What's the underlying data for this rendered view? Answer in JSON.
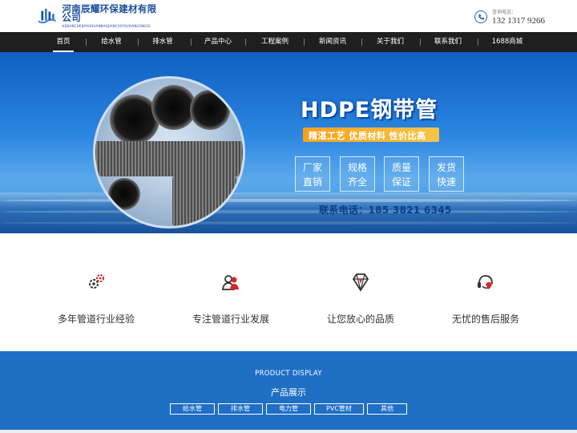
{
  "header": {
    "logo_cn": "河南辰耀环保建材有限公司",
    "logo_en": "HENANCHENYAOHUANBAOJIANCAIYOUXIANGONGSI",
    "hotline_label": "咨询电话：",
    "hotline_number": "132 1317 9266"
  },
  "nav": {
    "items": [
      {
        "label": "首页",
        "active": true
      },
      {
        "label": "给水管"
      },
      {
        "label": "排水管"
      },
      {
        "label": "产品中心"
      },
      {
        "label": "工程案例"
      },
      {
        "label": "新闻资讯"
      },
      {
        "label": "关于我们"
      },
      {
        "label": "联系我们"
      },
      {
        "label": "1688商城"
      }
    ]
  },
  "banner": {
    "title": "HDPE钢带管",
    "tagline": "精湛工艺 优质材料 性价比高",
    "features": [
      {
        "line1": "厂家",
        "line2": "直销"
      },
      {
        "line1": "规格",
        "line2": "齐全"
      },
      {
        "line1": "质量",
        "line2": "保证"
      },
      {
        "line1": "发货",
        "line2": "快速"
      }
    ],
    "contact": "联系电话：185 3821 6345"
  },
  "features": [
    {
      "label": "多年管道行业经验",
      "icon": "gears-icon"
    },
    {
      "label": "专注管道行业发展",
      "icon": "team-icon"
    },
    {
      "label": "让您放心的品质",
      "icon": "diamond-icon"
    },
    {
      "label": "无忧的售后服务",
      "icon": "headset-icon"
    }
  ],
  "products": {
    "title_en": "PRODUCT DISPLAY",
    "title_cn": "产品展示",
    "tabs": [
      "给水管",
      "排水管",
      "电力管",
      "PVC管材",
      "其他"
    ]
  },
  "colors": {
    "nav_bg": "#1f1f1f",
    "brand_blue": "#1a4f9c",
    "product_bg": "#1f6fc5",
    "accent_orange": "#f9a11b",
    "icon_red": "#d7262b"
  }
}
